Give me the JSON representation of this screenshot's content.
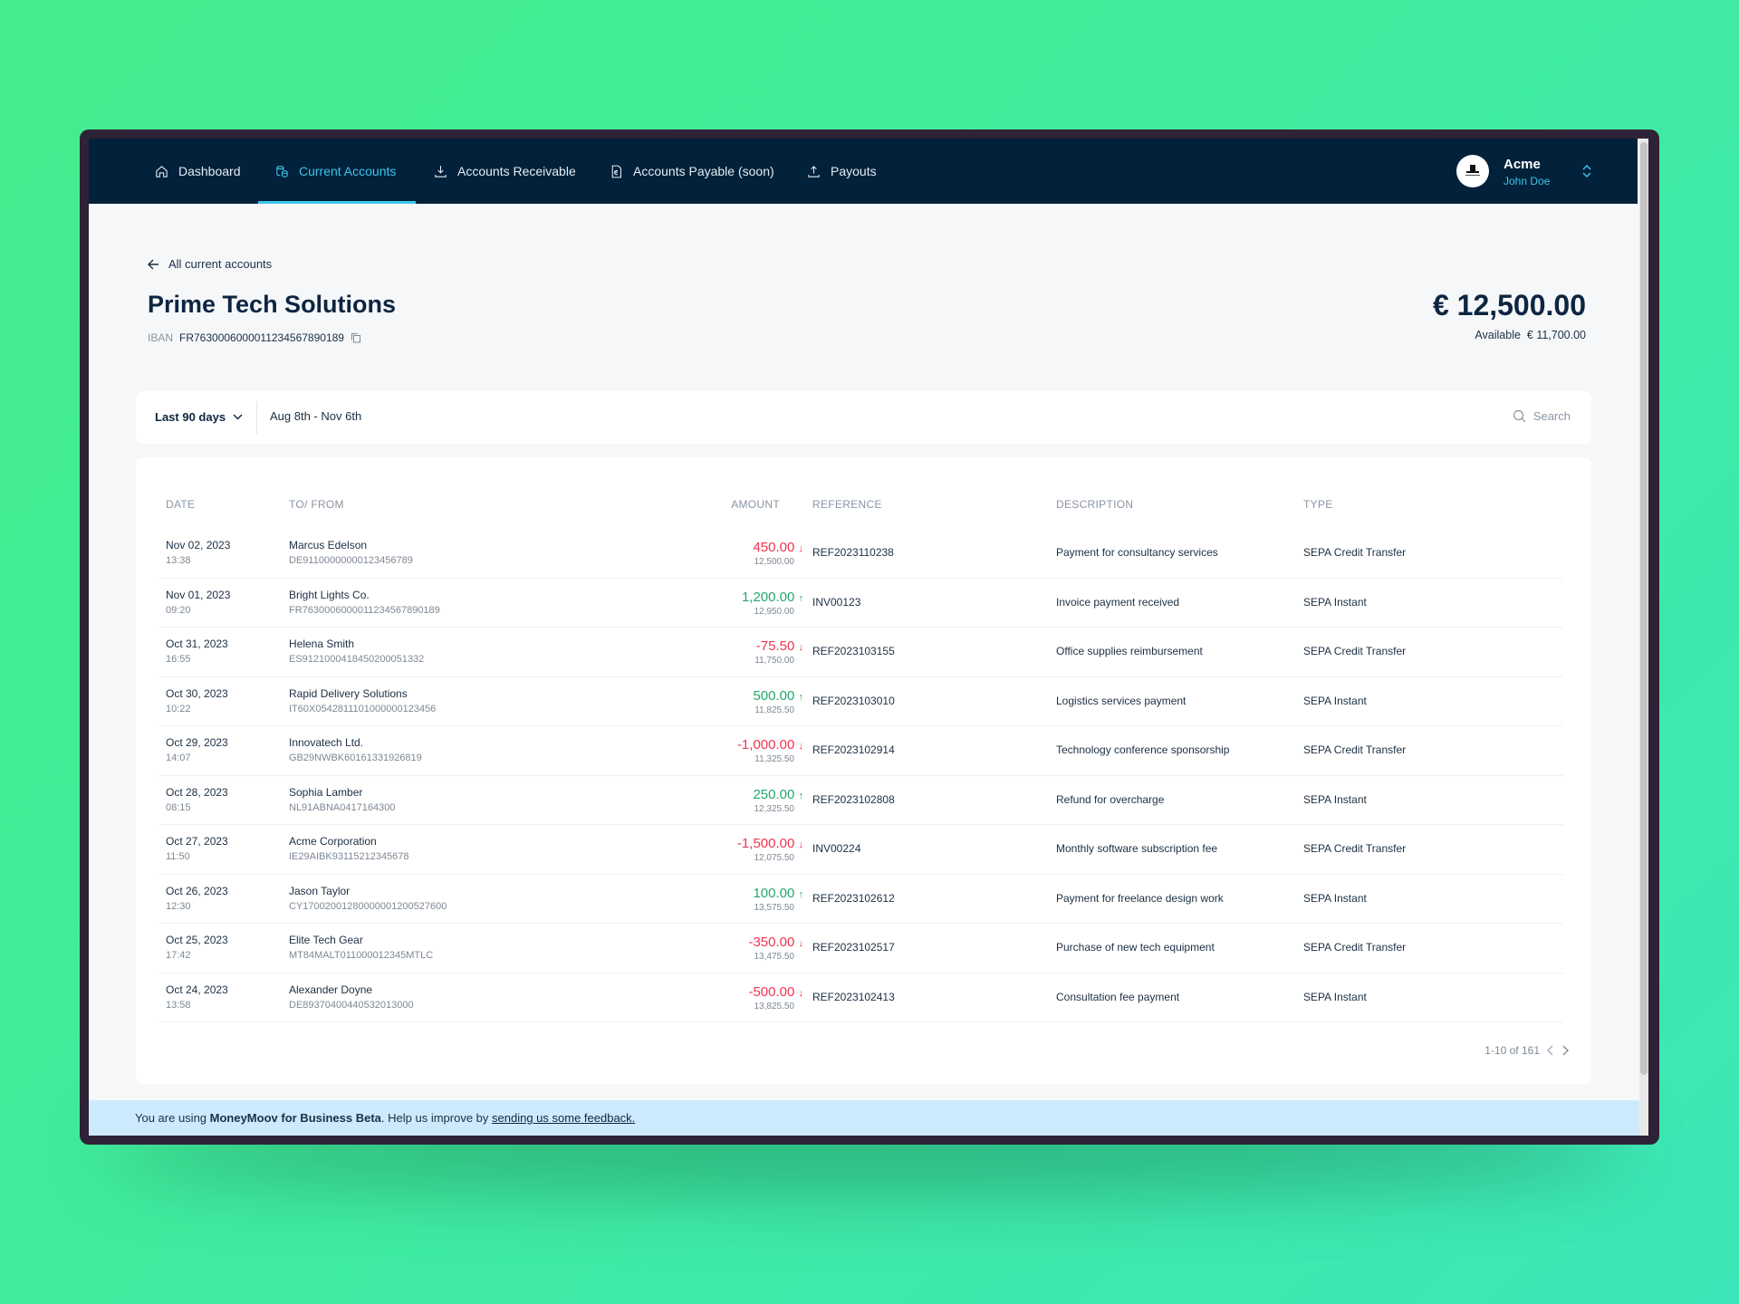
{
  "nav": {
    "items": [
      {
        "label": "Dashboard",
        "icon": "home-icon"
      },
      {
        "label": "Current Accounts",
        "icon": "coins-icon",
        "active": true
      },
      {
        "label": "Accounts Receivable",
        "icon": "download-icon"
      },
      {
        "label": "Accounts Payable (soon)",
        "icon": "euro-document-icon"
      },
      {
        "label": "Payouts",
        "icon": "upload-icon"
      }
    ],
    "org": "Acme",
    "user": "John Doe"
  },
  "page": {
    "back": "All current accounts",
    "title": "Prime Tech Solutions",
    "iban_label": "IBAN",
    "iban": "FR7630006000011234567890189",
    "balance": "€ 12,500.00",
    "available_label": "Available",
    "available": "€ 11,700.00"
  },
  "filter": {
    "period": "Last 90 days",
    "range": "Aug 8th - Nov 6th",
    "search_placeholder": "Search"
  },
  "table": {
    "headers": {
      "date": "DATE",
      "party": "TO/ FROM",
      "amount": "AMOUNT",
      "reference": "REFERENCE",
      "description": "DESCRIPTION",
      "type": "TYPE"
    },
    "rows": [
      {
        "date": "Nov 02, 2023",
        "time": "13:38",
        "name": "Marcus Edelson",
        "iban": "DE91100000000123456789",
        "amount": "450.00",
        "dir": "out",
        "balance": "12,500.00",
        "reference": "REF2023110238",
        "description": "Payment for consultancy services",
        "type": "SEPA Credit Transfer"
      },
      {
        "date": "Nov 01, 2023",
        "time": "09:20",
        "name": "Bright Lights Co.",
        "iban": "FR7630006000011234567890189",
        "amount": "1,200.00",
        "dir": "in",
        "balance": "12,950.00",
        "reference": "INV00123",
        "description": "Invoice payment received",
        "type": "SEPA Instant"
      },
      {
        "date": "Oct 31, 2023",
        "time": "16:55",
        "name": "Helena Smith",
        "iban": "ES9121000418450200051332",
        "amount": "-75.50",
        "dir": "out",
        "balance": "11,750.00",
        "reference": "REF2023103155",
        "description": "Office supplies reimbursement",
        "type": "SEPA Credit Transfer"
      },
      {
        "date": "Oct 30, 2023",
        "time": "10:22",
        "name": "Rapid Delivery Solutions",
        "iban": "IT60X0542811101000000123456",
        "amount": "500.00",
        "dir": "in",
        "balance": "11,825.50",
        "reference": "REF2023103010",
        "description": "Logistics services payment",
        "type": "SEPA Instant"
      },
      {
        "date": "Oct 29, 2023",
        "time": "14:07",
        "name": "Innovatech Ltd.",
        "iban": "GB29NWBK60161331926819",
        "amount": "-1,000.00",
        "dir": "out",
        "balance": "11,325.50",
        "reference": "REF2023102914",
        "description": "Technology conference sponsorship",
        "type": "SEPA Credit Transfer"
      },
      {
        "date": "Oct 28, 2023",
        "time": "08:15",
        "name": "Sophia Lamber",
        "iban": "NL91ABNA0417164300",
        "amount": "250.00",
        "dir": "in",
        "balance": "12,325.50",
        "reference": "REF2023102808",
        "description": "Refund for overcharge",
        "type": "SEPA Instant"
      },
      {
        "date": "Oct 27, 2023",
        "time": "11:50",
        "name": "Acme Corporation",
        "iban": "IE29AIBK93115212345678",
        "amount": "-1,500.00",
        "dir": "out",
        "balance": "12,075.50",
        "reference": "INV00224",
        "description": "Monthly software subscription fee",
        "type": "SEPA Credit Transfer"
      },
      {
        "date": "Oct 26, 2023",
        "time": "12:30",
        "name": "Jason Taylor",
        "iban": "CY17002001280000001200527600",
        "amount": "100.00",
        "dir": "in",
        "balance": "13,575.50",
        "reference": "REF2023102612",
        "description": "Payment for freelance design work",
        "type": "SEPA Instant"
      },
      {
        "date": "Oct 25, 2023",
        "time": "17:42",
        "name": "Elite Tech Gear",
        "iban": "MT84MALT011000012345MTLC",
        "amount": "-350.00",
        "dir": "out",
        "balance": "13,475.50",
        "reference": "REF2023102517",
        "description": "Purchase of new tech equipment",
        "type": "SEPA Credit Transfer"
      },
      {
        "date": "Oct 24, 2023",
        "time": "13:58",
        "name": "Alexander Doyne",
        "iban": "DE89370400440532013000",
        "amount": "-500.00",
        "dir": "out",
        "balance": "13,825.50",
        "reference": "REF2023102413",
        "description": "Consultation fee payment",
        "type": "SEPA Instant"
      }
    ],
    "pagination": "1-10 of 161"
  },
  "banner": {
    "prefix": "You are using ",
    "product": "MoneyMoov for Business Beta",
    "middle": ". Help us improve by ",
    "link": "sending us some feedback."
  },
  "colors": {
    "nav_bg": "#02213a",
    "accent": "#3fc4ea",
    "negative": "#f0334f",
    "positive": "#23a86b",
    "banner_bg": "#cdeafd"
  }
}
